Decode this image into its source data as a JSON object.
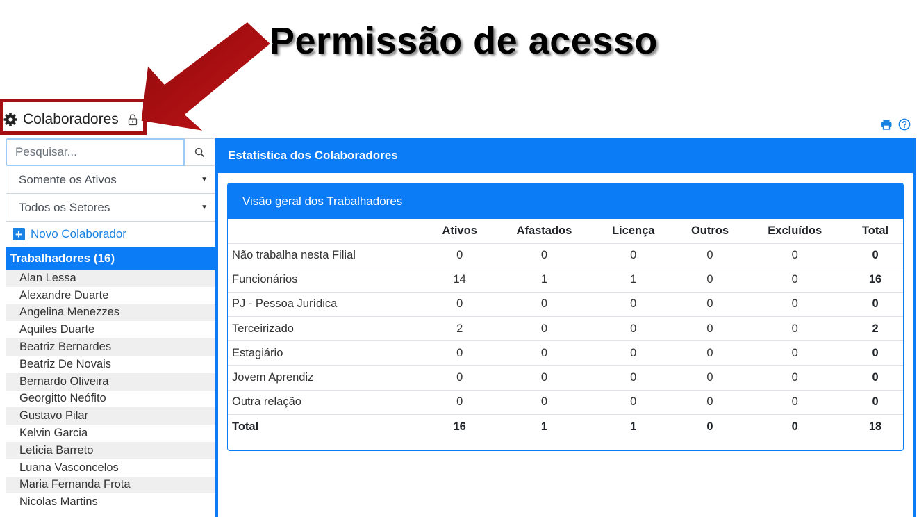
{
  "annotation": {
    "title": "Permissão de acesso"
  },
  "module": {
    "title": "Colaboradores",
    "icon": "gear-icon",
    "lock_icon": "lock-icon"
  },
  "toolbar": {
    "print_icon": "printer-icon",
    "help_icon": "help-icon"
  },
  "sidebar": {
    "search": {
      "placeholder": "Pesquisar...",
      "value": ""
    },
    "status_filter": "Somente os Ativos",
    "sector_filter": "Todos os Setores",
    "new_button_label": "Novo Colaborador",
    "workers_header": "Trabalhadores (16)",
    "workers": [
      "Alan Lessa",
      "Alexandre Duarte",
      "Angelina Menezzes",
      "Aquiles Duarte",
      "Beatriz Bernardes",
      "Beatriz De Novais",
      "Bernardo Oliveira",
      "Georgitto Neófito",
      "Gustavo Pilar",
      "Kelvin Garcia",
      "Leticia Barreto",
      "Luana Vasconcelos",
      "Maria Fernanda Frota",
      "Nicolas Martins"
    ]
  },
  "main": {
    "header": "Estatística dos Colaboradores",
    "card_title": "Visão geral dos Trabalhadores",
    "table": {
      "columns": [
        "",
        "Ativos",
        "Afastados",
        "Licença",
        "Outros",
        "Excluídos",
        "Total"
      ],
      "rows": [
        [
          "Não trabalha nesta Filial",
          "0",
          "0",
          "0",
          "0",
          "0",
          "0"
        ],
        [
          "Funcionários",
          "14",
          "1",
          "1",
          "0",
          "0",
          "16"
        ],
        [
          "PJ - Pessoa Jurídica",
          "0",
          "0",
          "0",
          "0",
          "0",
          "0"
        ],
        [
          "Terceirizado",
          "2",
          "0",
          "0",
          "0",
          "0",
          "2"
        ],
        [
          "Estagiário",
          "0",
          "0",
          "0",
          "0",
          "0",
          "0"
        ],
        [
          "Jovem Aprendiz",
          "0",
          "0",
          "0",
          "0",
          "0",
          "0"
        ],
        [
          "Outra relação",
          "0",
          "0",
          "0",
          "0",
          "0",
          "0"
        ]
      ],
      "total_row": [
        "Total",
        "16",
        "1",
        "1",
        "0",
        "0",
        "18"
      ]
    }
  },
  "colors": {
    "accent": "#0b7cf5",
    "link": "#1a82e2",
    "annotation_red": "#a30f12"
  }
}
